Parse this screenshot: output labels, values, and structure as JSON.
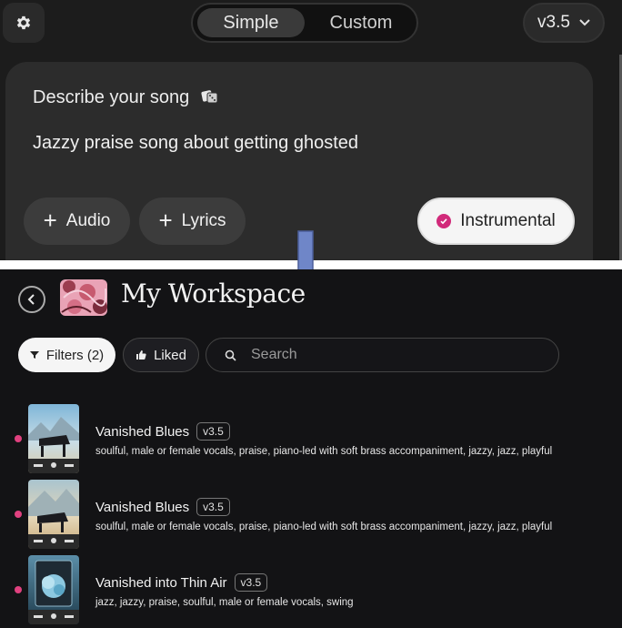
{
  "top": {
    "mode_tabs": [
      {
        "label": "Simple",
        "active": true
      },
      {
        "label": "Custom",
        "active": false
      }
    ],
    "version": "v3.5",
    "prompt_heading": "Describe your song",
    "prompt_text": "Jazzy praise song about getting ghosted",
    "buttons": {
      "audio": "Audio",
      "lyrics": "Lyrics",
      "instrumental": "Instrumental"
    }
  },
  "workspace": {
    "title": "My Workspace",
    "filters_label": "Filters (2)",
    "liked_label": "Liked",
    "search_placeholder": "Search",
    "songs": [
      {
        "title": "Vanished Blues",
        "version": "v3.5",
        "tags": "soulful, male or female vocals, praise, piano-led with soft brass accompaniment, jazzy, jazz, playful"
      },
      {
        "title": "Vanished Blues",
        "version": "v3.5",
        "tags": "soulful, male or female vocals, praise, piano-led with soft brass accompaniment, jazzy, jazz, playful"
      },
      {
        "title": "Vanished into Thin Air",
        "version": "v3.5",
        "tags": "jazz, jazzy, praise, soulful, male or female vocals, swing"
      }
    ]
  },
  "colors": {
    "accent_pink": "#d12a7a",
    "arrow_blue": "#6f86c8"
  }
}
